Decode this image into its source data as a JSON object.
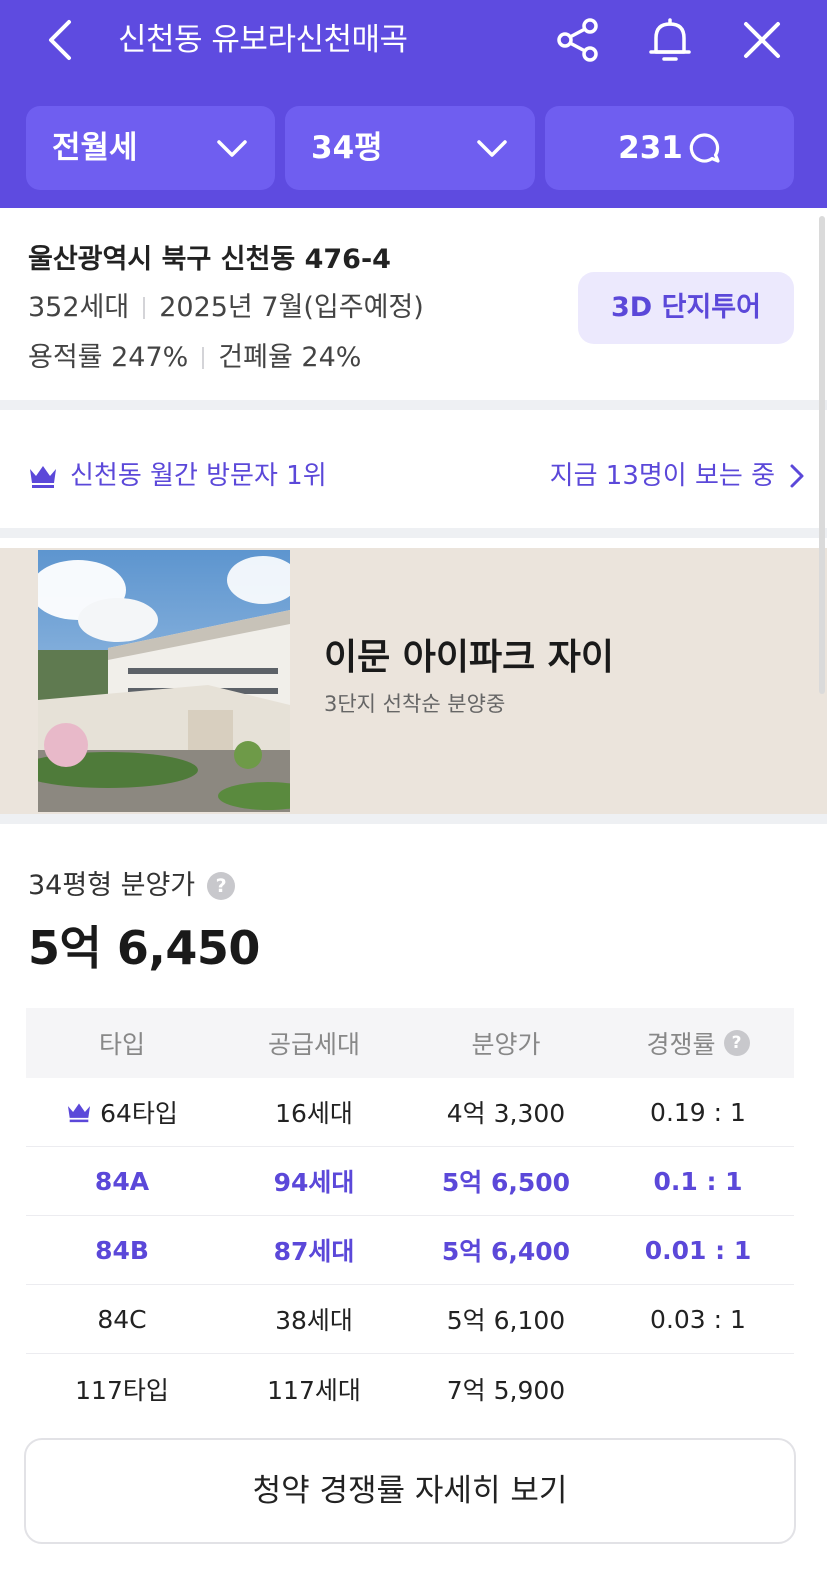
{
  "header": {
    "title": "신천동 유보라신천매곡",
    "icons": {
      "back": "chevron-left-icon",
      "share": "share-icon",
      "alarm": "bell-icon",
      "close": "close-icon"
    }
  },
  "filters": {
    "deal_type": "전월세",
    "size": "34평",
    "comments": "231"
  },
  "complex": {
    "address": "울산광역시 북구 신천동 476-4",
    "households": "352세대",
    "move_in": "2025년 7월(입주예정)",
    "floor_area_ratio": "용적률 247%",
    "building_coverage": "건폐율 24%",
    "tour_button": "3D 단지투어"
  },
  "visitors": {
    "rank_text": "신천동 월간 방문자 1위",
    "viewing_now": "지금 13명이 보는 중"
  },
  "ad": {
    "title": "이문 아이파크 자이",
    "subtitle": "3단지 선착순 분양중"
  },
  "pricing": {
    "label": "34평형 분양가",
    "value": "5억 6,450"
  },
  "supply_table": {
    "headers": [
      "타입",
      "공급세대",
      "분양가",
      "경쟁률"
    ],
    "rows": [
      {
        "type": "64타입",
        "units": "16세대",
        "price": "4억 3,300",
        "rate": "0.19 : 1",
        "crown": true,
        "highlight": false
      },
      {
        "type": "84A",
        "units": "94세대",
        "price": "5억 6,500",
        "rate": "0.1 : 1",
        "crown": false,
        "highlight": true
      },
      {
        "type": "84B",
        "units": "87세대",
        "price": "5억 6,400",
        "rate": "0.01 : 1",
        "crown": false,
        "highlight": true
      },
      {
        "type": "84C",
        "units": "38세대",
        "price": "5억 6,100",
        "rate": "0.03 : 1",
        "crown": false,
        "highlight": false
      },
      {
        "type": "117타입",
        "units": "117세대",
        "price": "7억 5,900",
        "rate": "",
        "crown": false,
        "highlight": false
      }
    ]
  },
  "detail_button": "청약 경쟁률 자세히 보기",
  "colors": {
    "brand": "#5e4be0",
    "filter_bg": "#6f5ef0",
    "accent_text": "#5b48d9",
    "tour_bg": "#ece9fd",
    "ad_bg": "#ebe4dc"
  }
}
